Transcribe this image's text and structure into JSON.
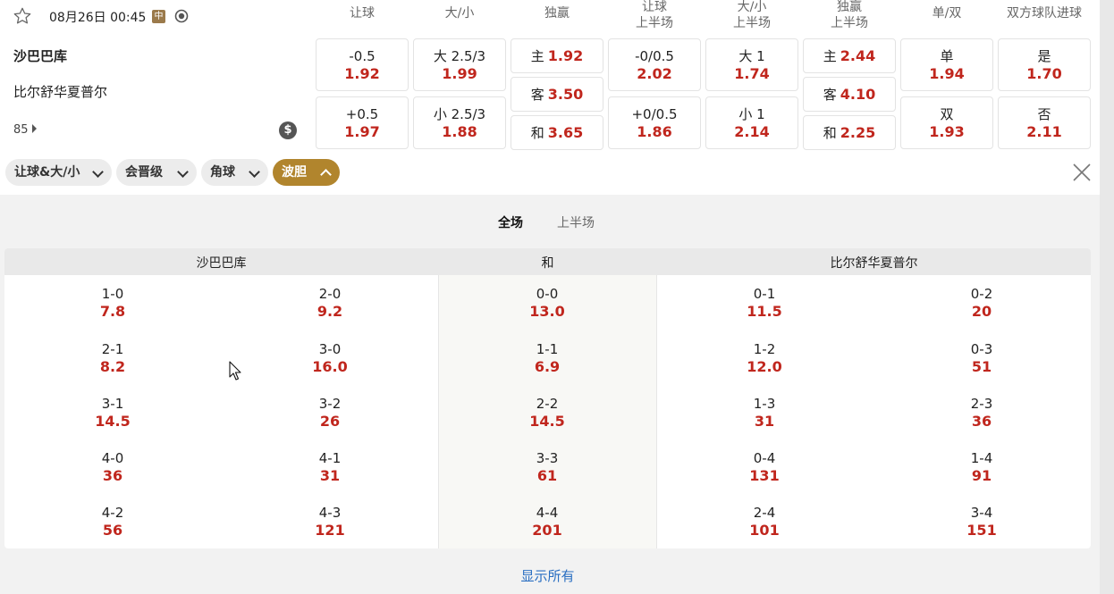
{
  "match": {
    "date_time": "08月26日 00:45",
    "zh_badge": "中",
    "home_team": "沙巴巴库",
    "away_team": "比尔舒华夏普尔",
    "more_count": "85",
    "dollar_symbol": "$"
  },
  "columns": [
    {
      "l1": "让球",
      "l2": ""
    },
    {
      "l1": "大/小",
      "l2": ""
    },
    {
      "l1": "独赢",
      "l2": ""
    },
    {
      "l1": "让球",
      "l2": "上半场"
    },
    {
      "l1": "大/小",
      "l2": "上半场"
    },
    {
      "l1": "独赢",
      "l2": "上半场"
    },
    {
      "l1": "单/双",
      "l2": ""
    },
    {
      "l1": "双方球队进球",
      "l2": ""
    }
  ],
  "odds": {
    "handicap": [
      {
        "label": "-0.5",
        "value": "1.92"
      },
      {
        "label": "+0.5",
        "value": "1.97"
      }
    ],
    "over_under": [
      {
        "label": "大 2.5/3",
        "value": "1.99"
      },
      {
        "label": "小 2.5/3",
        "value": "1.88"
      }
    ],
    "moneyline": [
      {
        "label": "主",
        "value": "1.92"
      },
      {
        "label": "客",
        "value": "3.50"
      },
      {
        "label": "和",
        "value": "3.65"
      }
    ],
    "handicap_1h": [
      {
        "label": "-0/0.5",
        "value": "2.02"
      },
      {
        "label": "+0/0.5",
        "value": "1.86"
      }
    ],
    "over_under_1h": [
      {
        "label": "大 1",
        "value": "1.74"
      },
      {
        "label": "小 1",
        "value": "2.14"
      }
    ],
    "moneyline_1h": [
      {
        "label": "主",
        "value": "2.44"
      },
      {
        "label": "客",
        "value": "4.10"
      },
      {
        "label": "和",
        "value": "2.25"
      }
    ],
    "odd_even": [
      {
        "label": "单",
        "value": "1.94"
      },
      {
        "label": "双",
        "value": "1.93"
      }
    ],
    "both_score": [
      {
        "label": "是",
        "value": "1.70"
      },
      {
        "label": "否",
        "value": "2.11"
      }
    ]
  },
  "market_tabs": [
    "让球&大/小",
    "会晋级",
    "角球",
    "波胆"
  ],
  "active_market_tab": "波胆",
  "period_tabs": {
    "full": "全场",
    "first_half": "上半场"
  },
  "score_table": {
    "headers": {
      "home": "沙巴巴库",
      "draw": "和",
      "away": "比尔舒华夏普尔"
    },
    "home_col1": [
      {
        "score": "1-0",
        "odds": "7.8"
      },
      {
        "score": "2-1",
        "odds": "8.2"
      },
      {
        "score": "3-1",
        "odds": "14.5"
      },
      {
        "score": "4-0",
        "odds": "36"
      },
      {
        "score": "4-2",
        "odds": "56"
      }
    ],
    "home_col2": [
      {
        "score": "2-0",
        "odds": "9.2"
      },
      {
        "score": "3-0",
        "odds": "16.0"
      },
      {
        "score": "3-2",
        "odds": "26"
      },
      {
        "score": "4-1",
        "odds": "31"
      },
      {
        "score": "4-3",
        "odds": "121"
      }
    ],
    "draw_col": [
      {
        "score": "0-0",
        "odds": "13.0"
      },
      {
        "score": "1-1",
        "odds": "6.9"
      },
      {
        "score": "2-2",
        "odds": "14.5"
      },
      {
        "score": "3-3",
        "odds": "61"
      },
      {
        "score": "4-4",
        "odds": "201"
      }
    ],
    "away_col1": [
      {
        "score": "0-1",
        "odds": "11.5"
      },
      {
        "score": "1-2",
        "odds": "12.0"
      },
      {
        "score": "1-3",
        "odds": "31"
      },
      {
        "score": "0-4",
        "odds": "131"
      },
      {
        "score": "2-4",
        "odds": "101"
      }
    ],
    "away_col2": [
      {
        "score": "0-2",
        "odds": "20"
      },
      {
        "score": "0-3",
        "odds": "51"
      },
      {
        "score": "2-3",
        "odds": "36"
      },
      {
        "score": "1-4",
        "odds": "91"
      },
      {
        "score": "3-4",
        "odds": "151"
      }
    ]
  },
  "show_all_label": "显示所有",
  "colors": {
    "accent_gold": "#b1852d",
    "odds_red": "#c0261d",
    "link_blue": "#2a6fc2"
  }
}
